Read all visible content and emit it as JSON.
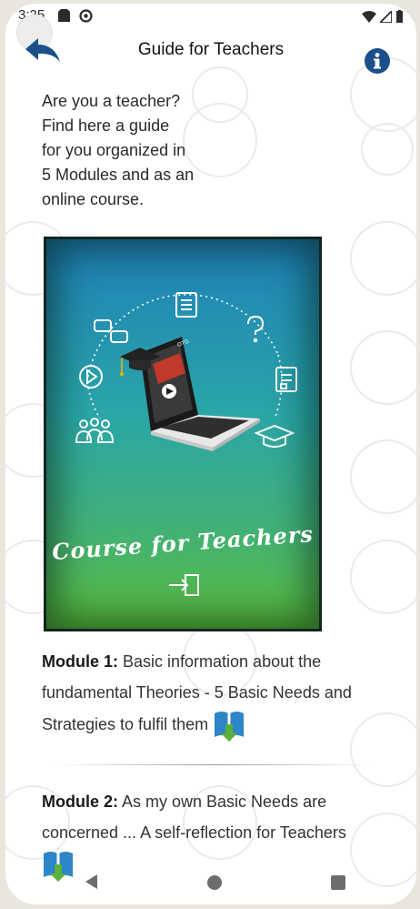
{
  "status": {
    "time": "3:25"
  },
  "appbar": {
    "title": "Guide for Teachers"
  },
  "intro": {
    "text": "Are you a teacher?\nFind here a guide\nfor you organized in\n5 Modules and as an\nonline course."
  },
  "cover": {
    "title": "Course for Teachers",
    "screen_badge": "OTG",
    "icons": [
      "document-icon",
      "chat-icon",
      "question-icon",
      "play-icon",
      "form-icon",
      "group-icon",
      "graduation-cap-icon",
      "laptop-icon",
      "enter-icon"
    ]
  },
  "modules": [
    {
      "label": "Module 1:",
      "text": " Basic information about the fundamental Theories - 5 Basic Needs and Strategies to fulfil them",
      "icon": "book-download-icon"
    },
    {
      "label": "Module 2:",
      "text": " As my own Basic Needs are concerned ... A self-reflection for Teachers",
      "icon": "book-download-icon"
    }
  ],
  "colors": {
    "accent": "#1c4f8a",
    "book_blue": "#2e86c9",
    "arrow_green": "#5bb03a"
  }
}
